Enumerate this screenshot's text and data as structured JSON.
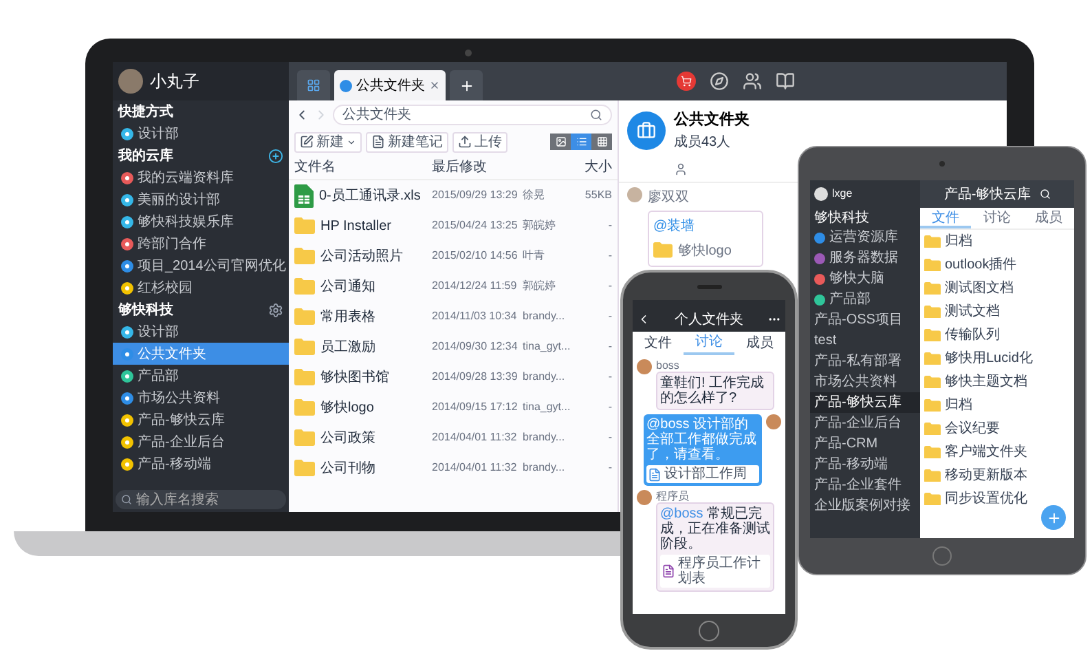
{
  "laptop": {
    "user": {
      "name": "小丸子"
    },
    "sidebar": [
      {
        "title": "快捷方式",
        "kind": "plain",
        "items": [
          {
            "label": "设计部",
            "color": "#35b7e8",
            "selected": false
          }
        ]
      },
      {
        "title": "我的云库",
        "kind": "add",
        "items": [
          {
            "label": "我的云端资料库",
            "color": "#e85a5a",
            "selected": false
          },
          {
            "label": "美丽的设计部",
            "color": "#35b7e8",
            "selected": false
          },
          {
            "label": "够快科技娱乐库",
            "color": "#35b7e8",
            "selected": false
          },
          {
            "label": "跨部门合作",
            "color": "#e85a5a",
            "selected": false
          },
          {
            "label": "项目_2014公司官网优化",
            "color": "#2e8de6",
            "selected": false
          },
          {
            "label": "红杉校园",
            "color": "#f2c200",
            "selected": false
          }
        ]
      },
      {
        "title": "够快科技",
        "kind": "settings",
        "items": [
          {
            "label": "设计部",
            "color": "#35b7e8",
            "selected": false
          },
          {
            "label": "公共文件夹",
            "color": "#2e8de6",
            "selected": true
          },
          {
            "label": "产品部",
            "color": "#2fc59a",
            "selected": false
          },
          {
            "label": "市场公共资料",
            "color": "#2e8de6",
            "selected": false
          },
          {
            "label": "产品-够快云库",
            "color": "#f2c200",
            "selected": false
          },
          {
            "label": "产品-企业后台",
            "color": "#f2c200",
            "selected": false
          },
          {
            "label": "产品-移动端",
            "color": "#f2c200",
            "selected": false
          }
        ]
      }
    ],
    "search": {
      "placeholder": "输入库名搜索"
    },
    "tabs": [
      {
        "label": "公共文件夹",
        "selected": true
      }
    ],
    "path": "公共文件夹",
    "buttons": [
      {
        "label": "新建",
        "kind": "menu"
      },
      {
        "label": "新建笔记",
        "kind": "note"
      },
      {
        "label": "上传",
        "kind": "upload"
      }
    ],
    "views": [
      {
        "kind": "gallery",
        "selected": false
      },
      {
        "kind": "list",
        "selected": true
      },
      {
        "kind": "grid",
        "selected": false
      }
    ],
    "columns": [
      "文件名",
      "最后修改",
      "大小"
    ],
    "files": [
      {
        "kind": "excel",
        "name": "0-员工通讯录.xls",
        "modified": "2015/09/29 13:29",
        "author": "徐晃",
        "size": "55KB"
      },
      {
        "kind": "folder",
        "name": "HP Installer",
        "modified": "2015/04/24 13:25",
        "author": "郭皖婷",
        "size": "-"
      },
      {
        "kind": "folder",
        "name": "公司活动照片",
        "modified": "2015/02/10 14:56",
        "author": "叶青",
        "size": "-"
      },
      {
        "kind": "folder",
        "name": "公司通知",
        "modified": "2014/12/24 11:59",
        "author": "郭皖婷",
        "size": "-"
      },
      {
        "kind": "folder",
        "name": "常用表格",
        "modified": "2014/11/03 10:34",
        "author": "brandy...",
        "size": "-"
      },
      {
        "kind": "folder",
        "name": "员工激励",
        "modified": "2014/09/30 12:34",
        "author": "tina_gyt...",
        "size": "-"
      },
      {
        "kind": "folder",
        "name": "够快图书馆",
        "modified": "2014/09/28 13:39",
        "author": "brandy...",
        "size": "-"
      },
      {
        "kind": "folder",
        "name": "够快logo",
        "modified": "2014/09/15 17:12",
        "author": "tina_gyt...",
        "size": "-"
      },
      {
        "kind": "folder",
        "name": "公司政策",
        "modified": "2014/04/01 11:32",
        "author": "brandy...",
        "size": "-"
      },
      {
        "kind": "folder",
        "name": "公司刊物",
        "modified": "2014/04/01 11:32",
        "author": "brandy...",
        "size": "-"
      }
    ],
    "panel": {
      "title": "公共文件夹",
      "subtitle": "成员43人",
      "message": {
        "sender": "廖双双",
        "mention": "@装墙",
        "file": "够快logo"
      }
    }
  },
  "tablet": {
    "user": "lxge",
    "section": "够快科技",
    "items": [
      {
        "label": "运营资源库",
        "color": "#2e8de6",
        "selected": false
      },
      {
        "label": "服务器数据",
        "color": "#9b59b6",
        "selected": false
      },
      {
        "label": "够快大脑",
        "color": "#e85a5a",
        "selected": false
      },
      {
        "label": "产品部",
        "color": "#2fc59a",
        "selected": false
      },
      {
        "label": "产品-OSS项目",
        "selected": false
      },
      {
        "label": "test",
        "selected": false
      },
      {
        "label": "产品-私有部署",
        "selected": false
      },
      {
        "label": "市场公共资料",
        "selected": false
      },
      {
        "label": "产品-够快云库",
        "selected": true
      },
      {
        "label": "产品-企业后台",
        "selected": false
      },
      {
        "label": "产品-CRM",
        "selected": false
      },
      {
        "label": "产品-移动端",
        "selected": false
      },
      {
        "label": "产品-企业套件",
        "selected": false
      },
      {
        "label": "企业版案例对接",
        "selected": false
      }
    ],
    "title": "产品-够快云库",
    "tabs": [
      {
        "label": "文件",
        "selected": true
      },
      {
        "label": "讨论",
        "selected": false
      },
      {
        "label": "成员",
        "selected": false
      }
    ],
    "files": [
      "归档",
      "outlook插件",
      "测试图文档",
      "测试文档",
      "传输队列",
      "够快用Lucid化",
      "够快主题文档",
      "归档",
      "会议纪要",
      "客户端文件夹",
      "移动更新版本",
      "同步设置优化"
    ]
  },
  "phone": {
    "title": "个人文件夹",
    "tabs": [
      {
        "label": "文件",
        "selected": false
      },
      {
        "label": "讨论",
        "selected": true
      },
      {
        "label": "成员",
        "selected": false
      }
    ],
    "messages": [
      {
        "kind": "received",
        "sender": "boss",
        "text": "童鞋们! 工作完成的怎么样了?"
      },
      {
        "kind": "sent",
        "mention": "@boss",
        "text": "设计部的全部工作都做完成了，请查看。",
        "file": "设计部工作周"
      },
      {
        "kind": "received",
        "sender": "程序员",
        "mention": "@boss",
        "text": "常规已完成，正在准备测试阶段。",
        "file": "程序员工作计划表"
      }
    ]
  }
}
